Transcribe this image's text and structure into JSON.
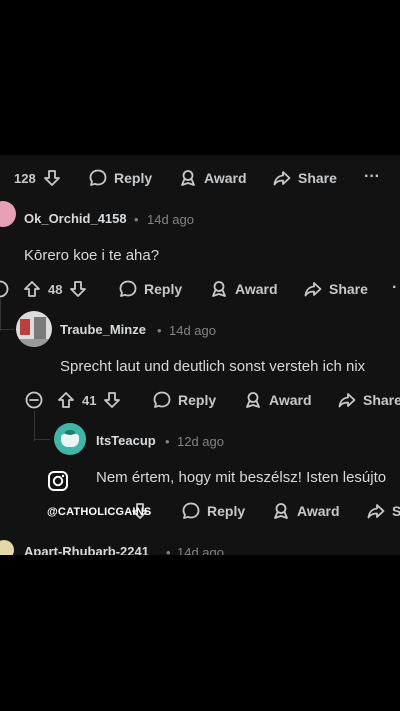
{
  "top_row": {
    "votes": "128",
    "reply": "Reply",
    "award": "Award",
    "share": "Share",
    "more": "···"
  },
  "comments": [
    {
      "user": "Ok_Orchid_4158",
      "time": "14d ago",
      "text": "Kōrero koe i te aha?",
      "votes": "48",
      "reply": "Reply",
      "award": "Award",
      "share": "Share",
      "more": "·"
    },
    {
      "user": "Traube_Minze",
      "time": "14d ago",
      "text": "Sprecht laut und deutlich sonst versteh ich nix",
      "votes": "41",
      "reply": "Reply",
      "award": "Award",
      "share": "Share"
    },
    {
      "user": "ItsTeacup",
      "time": "12d ago",
      "text": "Nem értem, hogy mit beszélsz! Isten lesújto",
      "reply": "Reply",
      "award": "Award",
      "share": "S"
    }
  ],
  "next_comment": {
    "user": "Apart-Rhubarb-2241",
    "time": "14d ago"
  },
  "watermark": {
    "handle": "@CATHOLICGAINS"
  },
  "separator": "•",
  "colors": {
    "bg": "#121213",
    "text": "#d7dadc",
    "muted": "#818384",
    "accent_pink": "#e8a0b4"
  }
}
